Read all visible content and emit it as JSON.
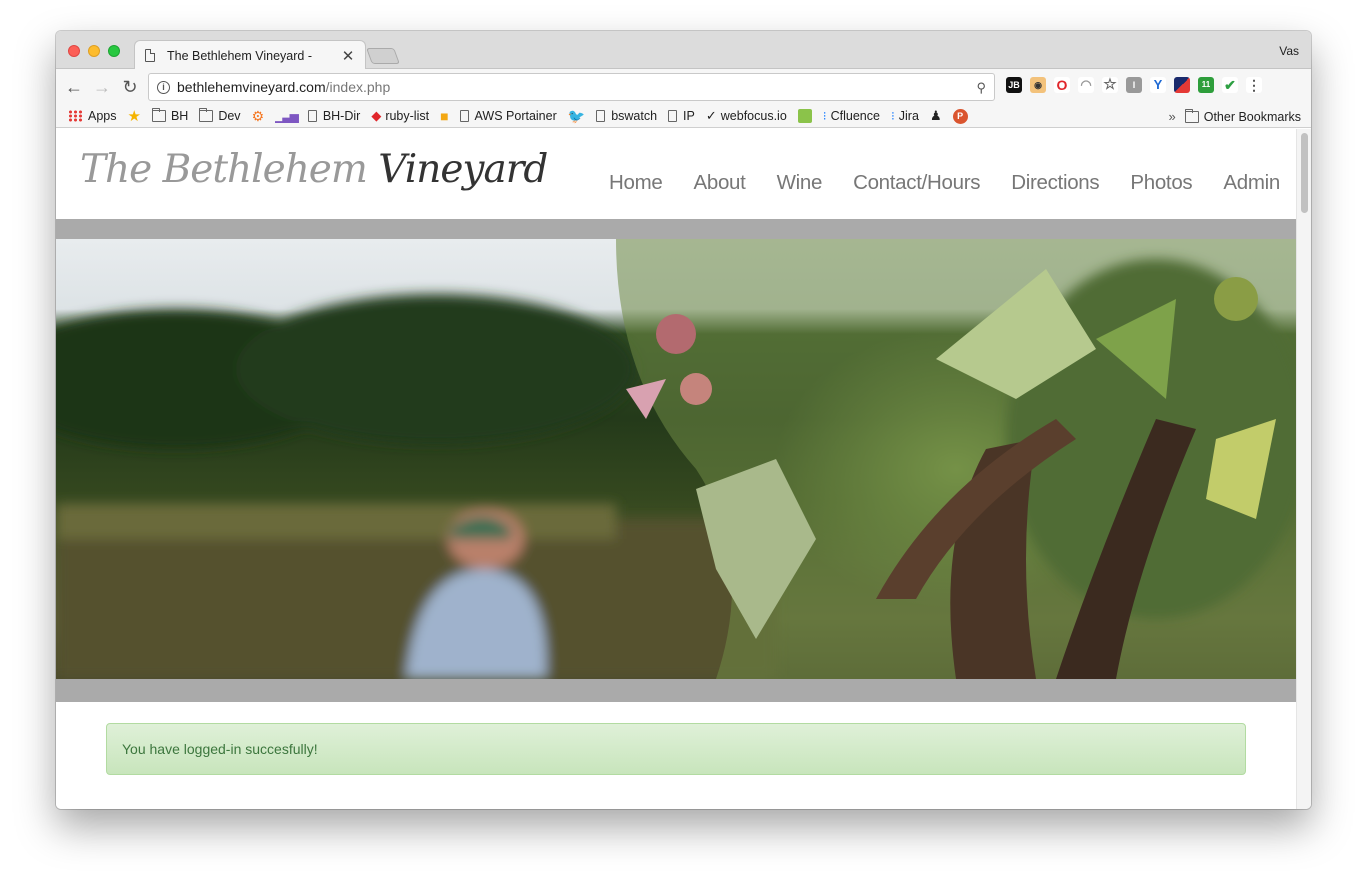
{
  "browser": {
    "tab_title": "The Bethlehem Vineyard -",
    "profile_name": "Vas",
    "url_host": "bethlehemvineyard.com",
    "url_path": "/index.php"
  },
  "bookmarks": [
    {
      "label": "Apps",
      "icon": "apps-grid-icon"
    },
    {
      "label": "",
      "icon": "star-icon"
    },
    {
      "label": "BH",
      "icon": "folder-icon"
    },
    {
      "label": "Dev",
      "icon": "folder-icon"
    },
    {
      "label": "",
      "icon": "hubspot-icon"
    },
    {
      "label": "",
      "icon": "analytics-icon"
    },
    {
      "label": "BH-Dir",
      "icon": "page-icon"
    },
    {
      "label": "ruby-list",
      "icon": "ruby-icon"
    },
    {
      "label": "",
      "icon": "box-icon"
    },
    {
      "label": "AWS Portainer",
      "icon": "page-icon"
    },
    {
      "label": "",
      "icon": "twitter-icon"
    },
    {
      "label": "bswatch",
      "icon": "page-icon"
    },
    {
      "label": "IP",
      "icon": "page-icon"
    },
    {
      "label": "webfocus.io",
      "icon": "check-circle-icon"
    },
    {
      "label": "",
      "icon": "green-square-icon"
    },
    {
      "label": "Cfluence",
      "icon": "confluence-icon"
    },
    {
      "label": "Jira",
      "icon": "jira-icon"
    },
    {
      "label": "",
      "icon": "character-icon"
    },
    {
      "label": "",
      "icon": "product-hunt-icon"
    }
  ],
  "other_bookmarks_label": "Other Bookmarks",
  "site": {
    "logo_light": "The Bethlehem",
    "logo_dark": "Vineyard",
    "nav": [
      "Home",
      "About",
      "Wine",
      "Contact/Hours",
      "Directions",
      "Photos",
      "Admin"
    ],
    "alert_message": "You have logged-in succesfully!"
  },
  "colors": {
    "alert_bg": "#dff0d8",
    "alert_text": "#3c763d",
    "band_gray": "#aaaaaa",
    "nav_text": "#777777"
  }
}
